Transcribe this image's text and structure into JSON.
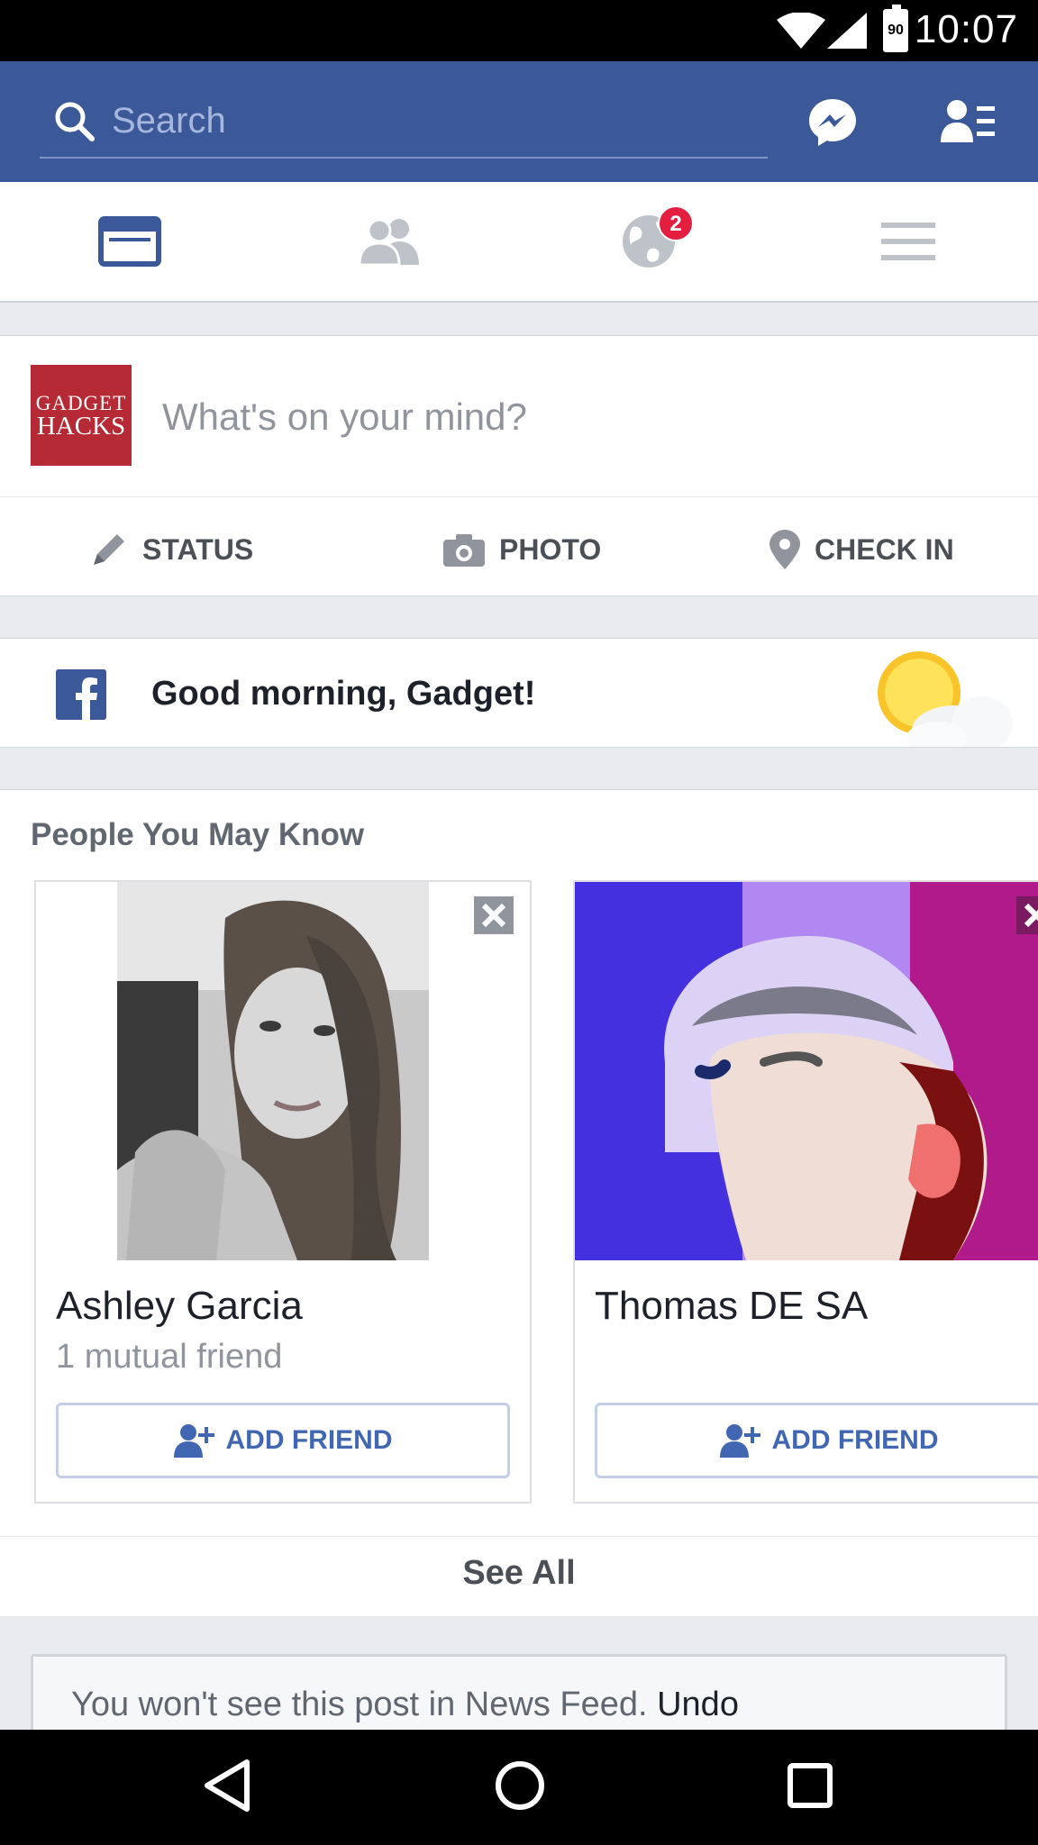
{
  "status_bar": {
    "time": "10:07",
    "battery_level": "90"
  },
  "search": {
    "placeholder": "Search"
  },
  "composer": {
    "logo_line1": "GADGET",
    "logo_line2": "HACKS",
    "prompt": "What's on your mind?",
    "actions": [
      {
        "label": "STATUS",
        "icon": "pencil-icon"
      },
      {
        "label": "PHOTO",
        "icon": "camera-icon"
      },
      {
        "label": "CHECK IN",
        "icon": "location-pin-icon"
      }
    ]
  },
  "tabs": {
    "items": [
      "news-feed-icon",
      "friends-icon",
      "notifications-globe-icon",
      "menu-icon"
    ],
    "notifications_badge": "2"
  },
  "greeting": {
    "text": "Good morning, Gadget!"
  },
  "pymk": {
    "title": "People You May Know",
    "people": [
      {
        "name": "Ashley Garcia",
        "mutual": "1 mutual friend",
        "button": "ADD FRIEND"
      },
      {
        "name": "Thomas DE SA",
        "mutual": "",
        "button": "ADD FRIEND"
      }
    ],
    "see_all": "See All"
  },
  "hidden_post": {
    "message": "You won't see this post in News Feed.",
    "undo": "Undo"
  },
  "colors": {
    "brand": "#3b5998",
    "accent": "#4267b2",
    "badge": "#e41e3f"
  }
}
